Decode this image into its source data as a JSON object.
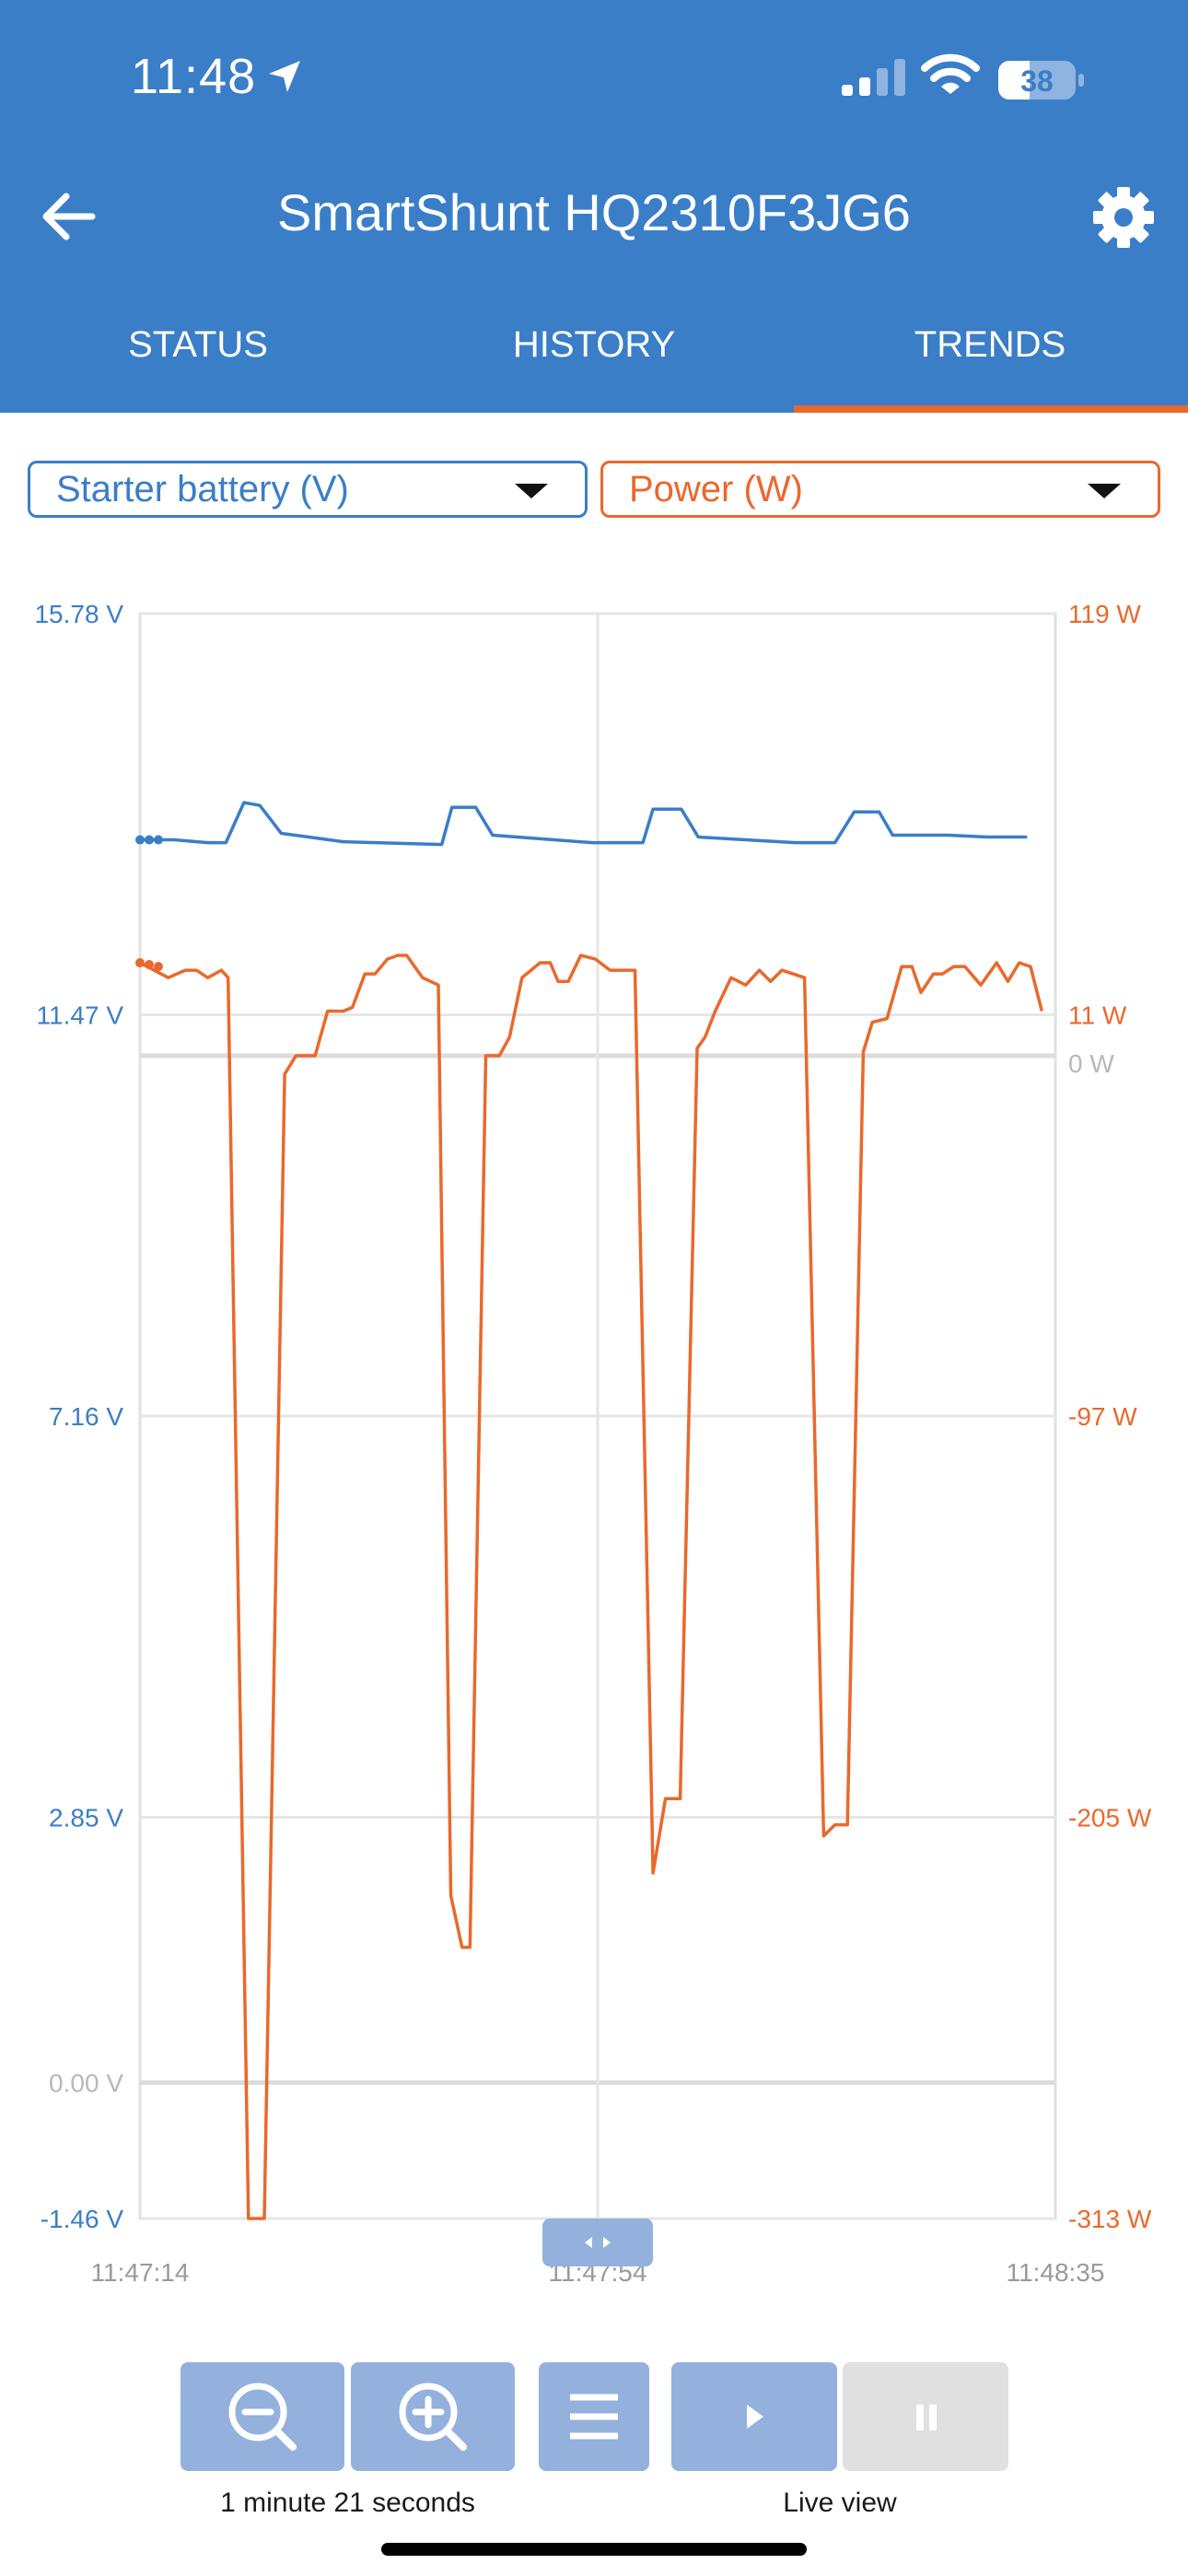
{
  "status_bar": {
    "time": "11:48",
    "battery": "38"
  },
  "app": {
    "title": "SmartShunt HQ2310F3JG6"
  },
  "tabs": [
    {
      "label": "STATUS",
      "active": false
    },
    {
      "label": "HISTORY",
      "active": false
    },
    {
      "label": "TRENDS",
      "active": true
    }
  ],
  "selectors": {
    "left": {
      "label": "Starter battery (V)",
      "color": "#3a7ec8"
    },
    "right": {
      "label": "Power (W)",
      "color": "#e9692c"
    }
  },
  "controls": {
    "zoom_caption": "1 minute 21 seconds",
    "live_caption": "Live view",
    "icons": [
      "zoom-out-icon",
      "zoom-in-icon",
      "menu-icon",
      "play-icon",
      "pause-icon"
    ]
  },
  "chart_data": {
    "type": "line",
    "x_ticks": [
      "11:47:14",
      "11:47:54",
      "11:48:35"
    ],
    "y_left_ticks": [
      "15.78 V",
      "11.47 V",
      "7.16 V",
      "2.85 V",
      "0.00 V",
      "-1.46 V"
    ],
    "y_right_ticks": [
      "119 W",
      "11 W",
      "0 W",
      "-97 W",
      "-205 W",
      "-313 W"
    ],
    "y_left_range": [
      -1.46,
      15.78
    ],
    "y_right_range": [
      -313,
      119
    ],
    "x_range_seconds": [
      0,
      81
    ],
    "grid": true,
    "series": [
      {
        "name": "Starter battery (V)",
        "axis": "left",
        "color": "#3a7ec8",
        "points": [
          [
            0,
            13.35
          ],
          [
            3,
            13.35
          ],
          [
            6,
            13.32
          ],
          [
            7.6,
            13.32
          ],
          [
            9.2,
            13.75
          ],
          [
            10.6,
            13.72
          ],
          [
            12.5,
            13.42
          ],
          [
            18,
            13.33
          ],
          [
            26.7,
            13.3
          ],
          [
            27.6,
            13.7
          ],
          [
            29.7,
            13.7
          ],
          [
            31.2,
            13.4
          ],
          [
            40,
            13.32
          ],
          [
            44.5,
            13.32
          ],
          [
            45.4,
            13.68
          ],
          [
            47.9,
            13.68
          ],
          [
            49.4,
            13.38
          ],
          [
            58,
            13.32
          ],
          [
            61.5,
            13.32
          ],
          [
            63.2,
            13.65
          ],
          [
            65.4,
            13.65
          ],
          [
            66.6,
            13.4
          ],
          [
            71.5,
            13.4
          ],
          [
            75,
            13.38
          ],
          [
            78.5,
            13.38
          ]
        ]
      },
      {
        "name": "Power (W)",
        "axis": "right",
        "color": "#e9692c",
        "points": [
          [
            0,
            25
          ],
          [
            2.5,
            21
          ],
          [
            4,
            23
          ],
          [
            5,
            23
          ],
          [
            6,
            21
          ],
          [
            7.2,
            23
          ],
          [
            7.8,
            21
          ],
          [
            9.6,
            -313
          ],
          [
            11,
            -313
          ],
          [
            12.8,
            -5
          ],
          [
            13.8,
            0
          ],
          [
            15.5,
            0
          ],
          [
            16.6,
            12
          ],
          [
            18,
            12
          ],
          [
            18.8,
            13
          ],
          [
            19.9,
            22
          ],
          [
            20.8,
            22
          ],
          [
            21.9,
            26
          ],
          [
            22.8,
            27
          ],
          [
            23.6,
            27
          ],
          [
            25,
            21
          ],
          [
            26.4,
            19
          ],
          [
            27.5,
            -226
          ],
          [
            28.5,
            -240
          ],
          [
            29.2,
            -240
          ],
          [
            30.6,
            0
          ],
          [
            31.8,
            0
          ],
          [
            32.7,
            5
          ],
          [
            33.8,
            21
          ],
          [
            35.4,
            25
          ],
          [
            36.3,
            25
          ],
          [
            37,
            20
          ],
          [
            37.9,
            20
          ],
          [
            39,
            27
          ],
          [
            40.3,
            26
          ],
          [
            41.6,
            23
          ],
          [
            43.8,
            23
          ],
          [
            45.4,
            -220
          ],
          [
            46.5,
            -200
          ],
          [
            47.8,
            -200
          ],
          [
            49.3,
            2
          ],
          [
            50,
            5
          ],
          [
            50.9,
            12
          ],
          [
            52.3,
            21
          ],
          [
            53.6,
            19
          ],
          [
            54.8,
            23
          ],
          [
            55.8,
            20
          ],
          [
            56.8,
            23
          ],
          [
            57.8,
            22
          ],
          [
            58.8,
            21
          ],
          [
            60.5,
            -210
          ],
          [
            61.5,
            -207
          ],
          [
            62.6,
            -207
          ],
          [
            64,
            1
          ],
          [
            64.8,
            9
          ],
          [
            66.1,
            10
          ],
          [
            67.4,
            24
          ],
          [
            68.3,
            24
          ],
          [
            69.1,
            17
          ],
          [
            70.2,
            22
          ],
          [
            71,
            22
          ],
          [
            72,
            24
          ],
          [
            73,
            24
          ],
          [
            74.4,
            19
          ],
          [
            75.8,
            25
          ],
          [
            76.8,
            20
          ],
          [
            77.8,
            25
          ],
          [
            78.8,
            24
          ],
          [
            79.8,
            12
          ]
        ]
      }
    ]
  }
}
